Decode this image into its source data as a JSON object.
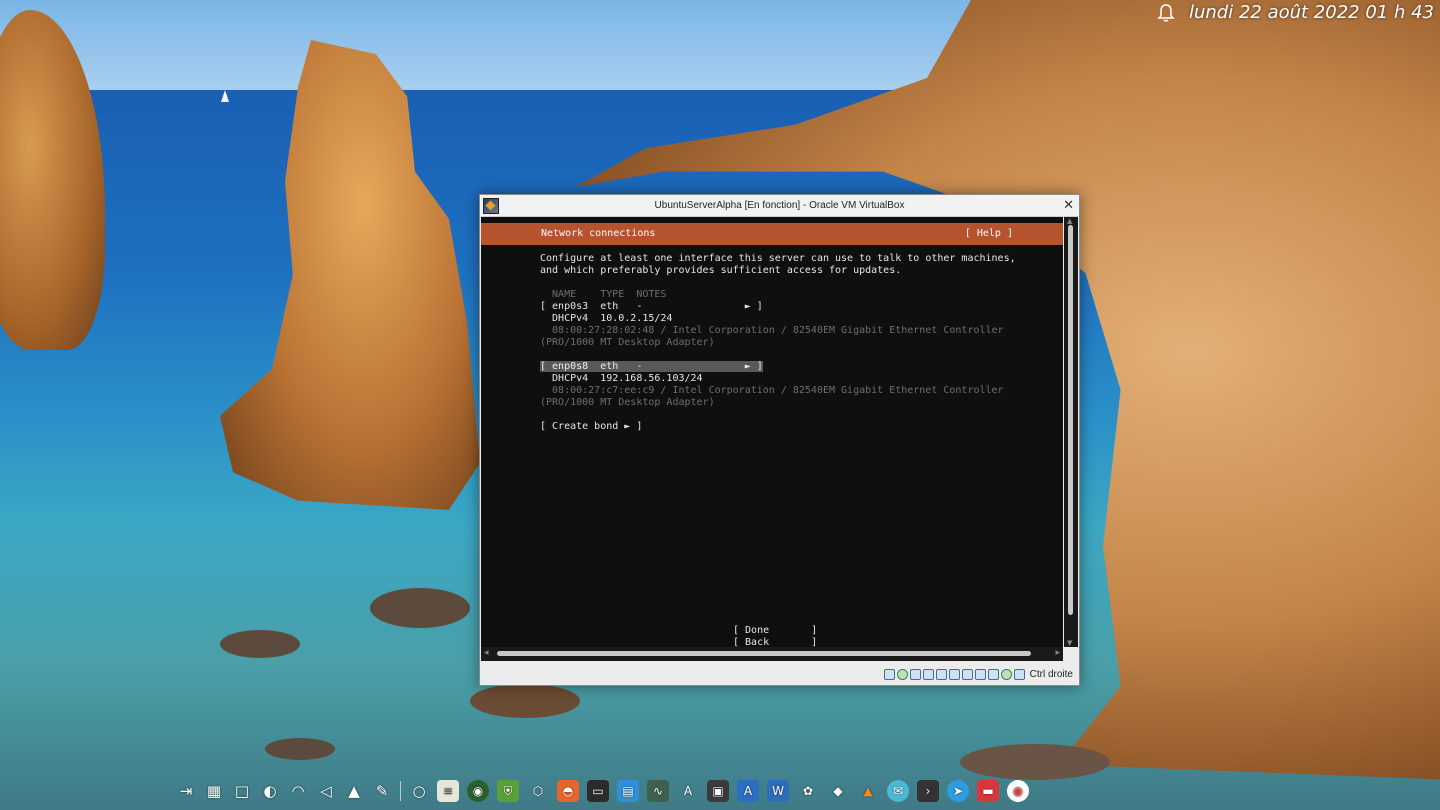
{
  "desktop": {
    "clock": "lundi 22 août 2022  01 h 43"
  },
  "window": {
    "title": "UbuntuServerAlpha [En fonction] - Oracle VM VirtualBox",
    "host_key": "Ctrl droite"
  },
  "installer": {
    "header_title": "Network connections",
    "help_label": "[ Help ]",
    "intro_line1": "Configure at least one interface this server can use to talk to other machines,",
    "intro_line2": "and which preferably provides sufficient access for updates.",
    "columns": "  NAME    TYPE  NOTES",
    "interfaces": [
      {
        "row": "[ enp0s3  eth   -                 ► ]",
        "addr": "  DHCPv4  10.0.2.15/24",
        "hw1": "  08:00:27:28:02:48 / Intel Corporation / 82540EM Gigabit Ethernet Controller",
        "hw2": "(PRO/1000 MT Desktop Adapter)"
      },
      {
        "row": "[ enp0s8  eth   -                 ► ]",
        "addr": "  DHCPv4  192.168.56.103/24",
        "hw1": "  08:00:27:c7:ee:c9 / Intel Corporation / 82540EM Gigabit Ethernet Controller",
        "hw2": "(PRO/1000 MT Desktop Adapter)"
      }
    ],
    "create_bond": "[ Create bond ► ]",
    "done_button": "[ Done       ]",
    "back_button": "[ Back       ]"
  },
  "taskbar": {
    "icons": [
      "launcher-icon",
      "apps-grid-icon",
      "show-desktop-icon",
      "night-light-icon",
      "wifi-icon",
      "volume-icon",
      "tray-expand-icon",
      "color-picker-icon",
      "search-icon",
      "notes-icon",
      "browser-icon",
      "vpn-icon",
      "virtualbox-icon",
      "app-orange-icon",
      "terminal-icon",
      "files-icon",
      "system-monitor-icon",
      "font-icon",
      "calculator-icon",
      "ide-icon",
      "word-icon",
      "gimp-icon",
      "inkscape-icon",
      "vlc-icon",
      "mail-icon",
      "console-icon",
      "telegram-icon",
      "file-manager-icon",
      "chrome-icon"
    ]
  }
}
